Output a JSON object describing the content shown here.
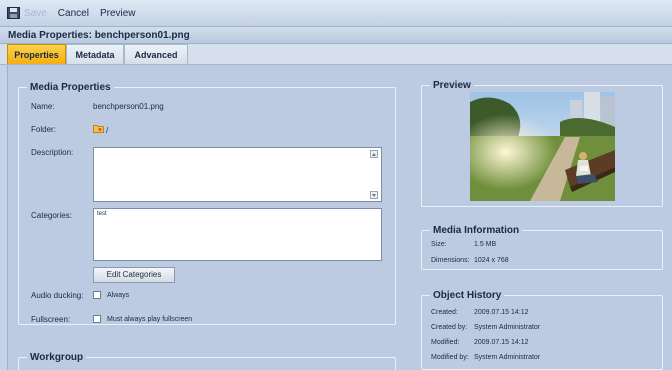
{
  "toolbar": {
    "save_label": "Save",
    "cancel_label": "Cancel",
    "preview_label": "Preview"
  },
  "title": "Media Properties: benchperson01.png",
  "tabs": [
    "Properties",
    "Metadata",
    "Advanced"
  ],
  "media_properties": {
    "legend": "Media Properties",
    "name_label": "Name:",
    "name_value": "benchperson01.png",
    "folder_label": "Folder:",
    "folder_value": "/",
    "description_label": "Description:",
    "description_value": "",
    "categories_label": "Categories:",
    "categories_value": "test",
    "edit_categories_label": "Edit Categories",
    "audio_ducking_label": "Audio ducking:",
    "audio_ducking_option": "Always",
    "fullscreen_label": "Fullscreen:",
    "fullscreen_option": "Must always play fullscreen"
  },
  "workgroup": {
    "legend": "Workgroup"
  },
  "preview": {
    "legend": "Preview"
  },
  "media_information": {
    "legend": "Media Information",
    "size_label": "Size:",
    "size_value": "1.5 MB",
    "dimensions_label": "Dimensions:",
    "dimensions_value": "1024 x 768"
  },
  "object_history": {
    "legend": "Object History",
    "created_label": "Created:",
    "created_value": "2009.07.15 14:12",
    "created_by_label": "Created by:",
    "created_by_value": "System Administrator",
    "modified_label": "Modified:",
    "modified_value": "2009.07.15 14:12",
    "modified_by_label": "Modified by:",
    "modified_by_value": "System Administrator"
  },
  "colors": {
    "active_tab": "#f5ae11",
    "panel_bg": "#bccbe2",
    "header_bg": "#c4d2e6"
  }
}
